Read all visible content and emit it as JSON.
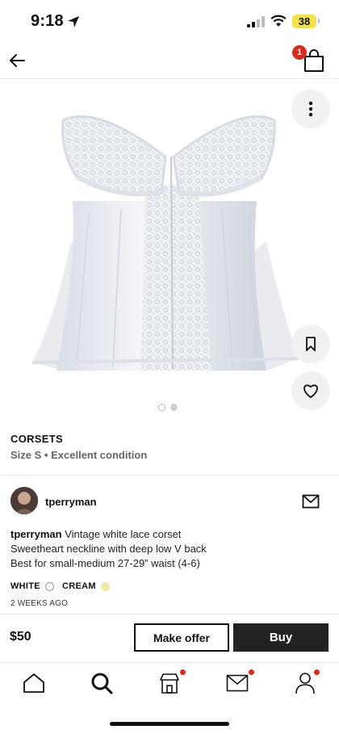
{
  "status_bar": {
    "time": "9:18",
    "battery": "38"
  },
  "nav": {
    "cart_count": "1"
  },
  "product": {
    "brand": "CORSETS",
    "size": "Size S",
    "separator": "•",
    "condition": "Excellent condition",
    "image_pages": 2,
    "current_image_page": 1
  },
  "seller": {
    "username": "tperryman"
  },
  "description": {
    "author": "tperryman",
    "line1": "Vintage white lace corset",
    "line2": "Sweetheart neckline with deep low V back",
    "line3": "Best for small-medium 27-29” waist (4-6)"
  },
  "colors": [
    {
      "name": "WHITE",
      "hex": "#ffffff"
    },
    {
      "name": "CREAM",
      "hex": "#f0e7a3"
    }
  ],
  "posted": "2 WEEKS AGO",
  "purchase": {
    "price": "$50",
    "offer_label": "Make offer",
    "buy_label": "Buy"
  },
  "tabs": [
    {
      "icon": "home-icon",
      "notification": false
    },
    {
      "icon": "search-icon",
      "notification": false
    },
    {
      "icon": "shop-icon",
      "notification": true
    },
    {
      "icon": "inbox-icon",
      "notification": true
    },
    {
      "icon": "profile-icon",
      "notification": true
    }
  ],
  "accent_color": "#d62e1c"
}
